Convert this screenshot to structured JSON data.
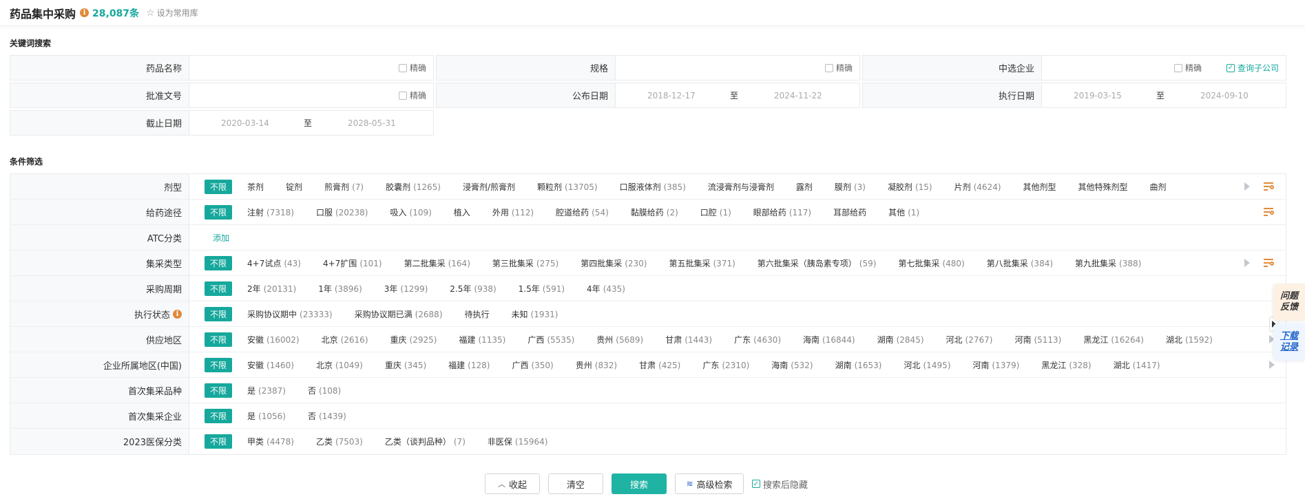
{
  "header": {
    "title": "药品集中采购",
    "info_icon": "info-icon",
    "count": "28,087条",
    "fav_label": "设为常用库"
  },
  "keyword_search": {
    "section_title": "关键词搜索",
    "exact_label": "精确",
    "fields": {
      "drug_name": {
        "label": "药品名称",
        "value": ""
      },
      "spec": {
        "label": "规格",
        "value": ""
      },
      "winner": {
        "label": "中选企业",
        "value": "",
        "sub_label": "查询子公司"
      },
      "approval": {
        "label": "批准文号",
        "value": ""
      },
      "publish_date": {
        "label": "公布日期",
        "from": "2018-12-17",
        "to": "2024-11-22"
      },
      "exec_date": {
        "label": "执行日期",
        "from": "2019-03-15",
        "to": "2024-09-10"
      },
      "deadline": {
        "label": "截止日期",
        "from": "2020-03-14",
        "to": "2028-05-31"
      }
    },
    "to_label": "至"
  },
  "filters": {
    "section_title": "条件筛选",
    "all_label": "不限",
    "add_label": "添加",
    "rows": [
      {
        "label": "剂型",
        "options": [
          [
            "茶剂",
            ""
          ],
          [
            "锭剂",
            ""
          ],
          [
            "煎膏剂",
            "(7)"
          ],
          [
            "胶囊剂",
            "(1265)"
          ],
          [
            "浸膏剂/煎膏剂",
            ""
          ],
          [
            "颗粒剂",
            "(13705)"
          ],
          [
            "口服液体剂",
            "(385)"
          ],
          [
            "流浸膏剂与浸膏剂",
            ""
          ],
          [
            "露剂",
            ""
          ],
          [
            "膜剂",
            "(3)"
          ],
          [
            "凝胶剂",
            "(15)"
          ],
          [
            "片剂",
            "(4624)"
          ],
          [
            "其他剂型",
            ""
          ],
          [
            "其他特殊剂型",
            ""
          ],
          [
            "曲剂",
            ""
          ]
        ]
      },
      {
        "label": "给药途径",
        "options": [
          [
            "注射",
            "(7318)"
          ],
          [
            "口服",
            "(20238)"
          ],
          [
            "吸入",
            "(109)"
          ],
          [
            "植入",
            ""
          ],
          [
            "外用",
            "(112)"
          ],
          [
            "腔道给药",
            "(54)"
          ],
          [
            "黏膜给药",
            "(2)"
          ],
          [
            "口腔",
            "(1)"
          ],
          [
            "眼部给药",
            "(117)"
          ],
          [
            "耳部给药",
            ""
          ],
          [
            "其他",
            "(1)"
          ]
        ]
      },
      {
        "label": "ATC分类",
        "options": []
      },
      {
        "label": "集采类型",
        "options": [
          [
            "4+7试点",
            "(43)"
          ],
          [
            "4+7扩围",
            "(101)"
          ],
          [
            "第二批集采",
            "(164)"
          ],
          [
            "第三批集采",
            "(275)"
          ],
          [
            "第四批集采",
            "(230)"
          ],
          [
            "第五批集采",
            "(371)"
          ],
          [
            "第六批集采（胰岛素专项）",
            "(59)"
          ],
          [
            "第七批集采",
            "(480)"
          ],
          [
            "第八批集采",
            "(384)"
          ],
          [
            "第九批集采",
            "(388)"
          ]
        ]
      },
      {
        "label": "采购周期",
        "options": [
          [
            "2年",
            "(20131)"
          ],
          [
            "1年",
            "(3896)"
          ],
          [
            "3年",
            "(1299)"
          ],
          [
            "2.5年",
            "(938)"
          ],
          [
            "1.5年",
            "(591)"
          ],
          [
            "4年",
            "(435)"
          ]
        ]
      },
      {
        "label": "执行状态",
        "options": [
          [
            "采购协议期中",
            "(23333)"
          ],
          [
            "采购协议期已满",
            "(2688)"
          ],
          [
            "待执行",
            ""
          ],
          [
            "未知",
            "(1931)"
          ]
        ]
      },
      {
        "label": "供应地区",
        "options": [
          [
            "安徽",
            "(16002)"
          ],
          [
            "北京",
            "(2616)"
          ],
          [
            "重庆",
            "(2925)"
          ],
          [
            "福建",
            "(1135)"
          ],
          [
            "广西",
            "(5535)"
          ],
          [
            "贵州",
            "(5689)"
          ],
          [
            "甘肃",
            "(1443)"
          ],
          [
            "广东",
            "(4630)"
          ],
          [
            "海南",
            "(16844)"
          ],
          [
            "湖南",
            "(2845)"
          ],
          [
            "河北",
            "(2767)"
          ],
          [
            "河南",
            "(5113)"
          ],
          [
            "黑龙江",
            "(16264)"
          ],
          [
            "湖北",
            "(1592)"
          ]
        ]
      },
      {
        "label": "企业所属地区(中国)",
        "options": [
          [
            "安徽",
            "(1460)"
          ],
          [
            "北京",
            "(1049)"
          ],
          [
            "重庆",
            "(345)"
          ],
          [
            "福建",
            "(128)"
          ],
          [
            "广西",
            "(350)"
          ],
          [
            "贵州",
            "(832)"
          ],
          [
            "甘肃",
            "(425)"
          ],
          [
            "广东",
            "(2310)"
          ],
          [
            "海南",
            "(532)"
          ],
          [
            "湖南",
            "(1653)"
          ],
          [
            "河北",
            "(1495)"
          ],
          [
            "河南",
            "(1379)"
          ],
          [
            "黑龙江",
            "(328)"
          ],
          [
            "湖北",
            "(1417)"
          ]
        ]
      },
      {
        "label": "首次集采品种",
        "options": [
          [
            "是",
            "(2387)"
          ],
          [
            "否",
            "(108)"
          ]
        ]
      },
      {
        "label": "首次集采企业",
        "options": [
          [
            "是",
            "(1056)"
          ],
          [
            "否",
            "(1439)"
          ]
        ]
      },
      {
        "label": "2023医保分类",
        "options": [
          [
            "甲类",
            "(4478)"
          ],
          [
            "乙类",
            "(7503)"
          ],
          [
            "乙类（谈判品种）",
            "(7)"
          ],
          [
            "非医保",
            "(15964)"
          ]
        ]
      }
    ]
  },
  "side": {
    "feedback": "问题反馈",
    "download": "下载记录"
  },
  "actions": {
    "collapse": "收起",
    "clear": "清空",
    "search": "搜索",
    "advanced": "高级检索",
    "hide_after": "搜索后隐藏"
  }
}
